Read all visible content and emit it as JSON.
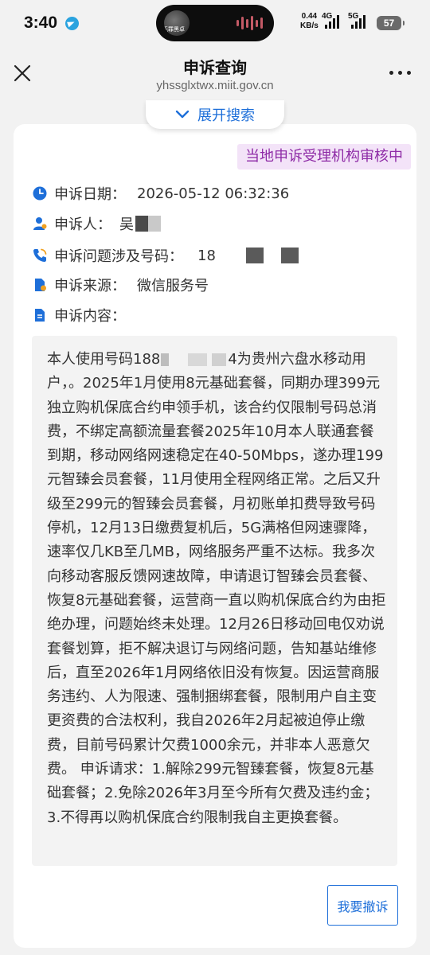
{
  "status_bar": {
    "time": "3:40",
    "island_text": "无罪黑卓",
    "net_speed": "0.44",
    "net_unit": "KB/s",
    "sim1_label": "4G",
    "sim2_label": "5G",
    "battery": "57"
  },
  "header": {
    "title": "申诉查询",
    "url": "yhssglxtwx.miit.gov.cn"
  },
  "search_toggle": {
    "label": "展开搜索"
  },
  "record": {
    "status": "当地申诉受理机构审核中",
    "date_label": "申诉日期：",
    "date_value": "2026-05-12 06:32:36",
    "complainant_label": "申诉人：",
    "complainant_value": "吴",
    "phone_label": "申诉问题涉及号码：",
    "phone_value": "18",
    "source_label": "申诉来源：",
    "source_value": "微信服务号",
    "content_label": "申诉内容：",
    "content_part1": "本人使用号码188",
    "content_part2": "4为贵州六盘水移动用户，。2025年1月使用8元基础套餐，同期办理399元独立购机保底合约申领手机，该合约仅限制号码总消费，不绑定高额流量套餐2025年10月本人联通套餐到期，移动网络网速稳定在40-50Mbps，遂办理199元智臻会员套餐，11月使用全程网络正常。之后又升级至299元的智臻会员套餐，月初账单扣费导致号码停机，12月13日缴费复机后，5G满格但网速骤降，速率仅几KB至几MB，网络服务严重不达标。我多次向移动客服反馈网速故障，申请退订智臻会员套餐、恢复8元基础套餐，运营商一直以购机保底合约为由拒绝办理，问题始终未处理。12月26日移动回电仅劝说套餐划算，拒不解决退订与网络问题，告知基站维修后，直至2026年1月网络依旧没有恢复。因运营商服务违约、人为限速、强制捆绑套餐，限制用户自主变更资费的合法权利，我自2026年2月起被迫停止缴费，目前号码累计欠费1000余元，并非本人恶意欠费。 申诉请求：1.解除299元智臻套餐，恢复8元基础套餐；2.免除2026年3月至今所有欠费及违约金；3.不得再以购机保底合约限制我自主更换套餐。"
  },
  "actions": {
    "withdraw_label": "我要撤诉"
  },
  "colors": {
    "accent": "#1e6fd9",
    "badge_bg": "#f3e3f8",
    "badge_text": "#8e2ba6",
    "page_bg": "#f2f2f2"
  },
  "icons": [
    "telegram-icon",
    "close-icon",
    "more-icon",
    "chevron-down-icon",
    "clock-icon",
    "person-icon",
    "phone-icon",
    "source-icon",
    "document-icon"
  ]
}
